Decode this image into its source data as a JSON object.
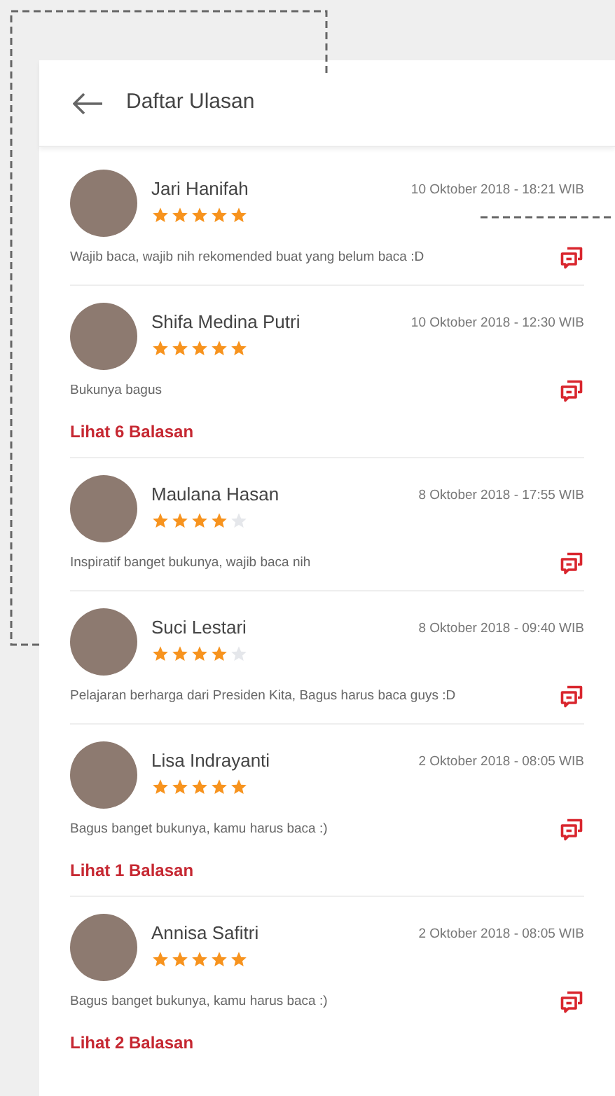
{
  "header": {
    "title": "Daftar Ulasan"
  },
  "reviews": [
    {
      "name": "Jari Hanifah",
      "date": "10 Oktober 2018 - 18:21 WIB",
      "stars": 5,
      "comment": "Wajib baca, wajib nih rekomended buat yang belum baca :D"
    },
    {
      "name": "Shifa Medina Putri",
      "date": "10 Oktober 2018 - 12:30 WIB",
      "stars": 5,
      "comment": "Bukunya bagus",
      "replies": "Lihat 6 Balasan"
    },
    {
      "name": "Maulana Hasan",
      "date": "8 Oktober 2018 - 17:55 WIB",
      "stars": 4,
      "comment": "Inspiratif banget bukunya, wajib baca nih"
    },
    {
      "name": "Suci Lestari",
      "date": "8 Oktober 2018 - 09:40 WIB",
      "stars": 4,
      "comment": "Pelajaran berharga dari Presiden Kita, Bagus harus baca guys :D"
    },
    {
      "name": "Lisa Indrayanti",
      "date": "2 Oktober 2018 - 08:05 WIB",
      "stars": 5,
      "comment": "Bagus banget bukunya, kamu harus baca :)",
      "replies": "Lihat 1 Balasan"
    },
    {
      "name": "Annisa Safitri",
      "date": "2 Oktober 2018 - 08:05 WIB",
      "stars": 5,
      "comment": "Bagus banget bukunya, kamu harus baca :)",
      "replies": "Lihat 2 Balasan"
    }
  ]
}
